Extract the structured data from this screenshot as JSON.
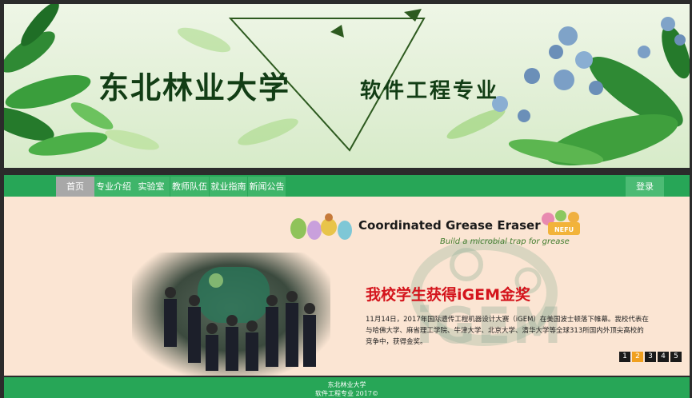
{
  "banner": {
    "title_main": "东北林业大学",
    "title_sub": "软件工程专业"
  },
  "nav": {
    "items": [
      {
        "label": "首页"
      },
      {
        "label": "专业介绍"
      },
      {
        "label": "实验室"
      },
      {
        "label": "教师队伍"
      },
      {
        "label": "就业指南"
      },
      {
        "label": "新闻公告"
      }
    ],
    "login_label": "登录"
  },
  "slide": {
    "logo_title": "Coordinated Grease Eraser",
    "logo_subtitle": "Build a microbial trap for grease",
    "logo_badge": "NEFU",
    "watermark": "iGEM",
    "headline": "我校学生获得iGEM金奖",
    "body": "11月14日，2017年国际遗传工程机器设计大赛（iGEM）在美国波士顿落下帷幕。我校代表在与哈佛大学、麻省理工学院、牛津大学、北京大学、清华大学等全球313所国内外顶尖高校的竞争中，获得金奖。",
    "pager": [
      "1",
      "2",
      "3",
      "4",
      "5"
    ],
    "active_page": "2"
  },
  "footer": {
    "line1": "东北林业大学",
    "line2": "软件工程专业 2017©"
  },
  "colors": {
    "nav_green": "#27a657",
    "headline_red": "#d4141c",
    "pager_active": "#f0a020"
  }
}
